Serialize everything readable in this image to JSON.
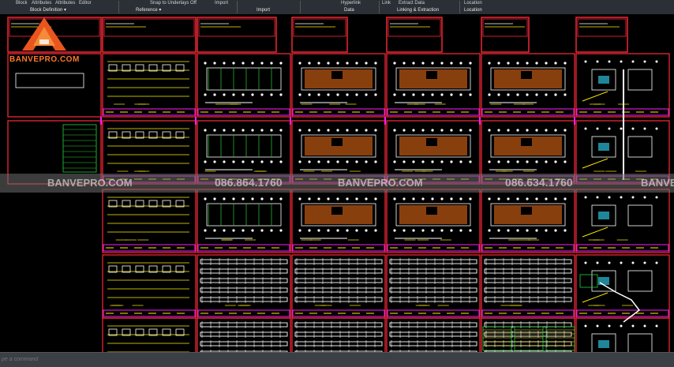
{
  "ribbon": {
    "top_labels": [
      {
        "text": "Block"
      },
      {
        "text": "Attributes"
      },
      {
        "text": "Attributes"
      },
      {
        "text": "Editor"
      },
      {
        "text": "Snap to Underlays Off"
      },
      {
        "text": "Import"
      },
      {
        "text": "Hyperlink"
      },
      {
        "text": "Link"
      },
      {
        "text": "Extract Data"
      },
      {
        "text": "Location"
      }
    ],
    "panels": [
      {
        "label": "Block Definition",
        "dropdown": true
      },
      {
        "label": "Reference",
        "dropdown": true
      },
      {
        "label": "Import",
        "dropdown": false
      },
      {
        "label": "Data",
        "dropdown": false
      },
      {
        "label": "Linking & Extraction",
        "dropdown": false
      },
      {
        "label": "Location",
        "dropdown": false
      }
    ]
  },
  "watermarks": {
    "logo_text": "BANVEPRO.COM",
    "site": "BANVEPRO.COM",
    "phone": "086.634.1760",
    "phone_alt": "086.864.1760"
  },
  "command_line": {
    "placeholder": "pe a command"
  },
  "colors": {
    "frame": "#ff2a3a",
    "magenta": "#ff1aff",
    "yellow": "#ffee00",
    "white": "#ffffff",
    "brown": "#a04a10",
    "green": "#27d03a",
    "cyan": "#33e0ff"
  }
}
